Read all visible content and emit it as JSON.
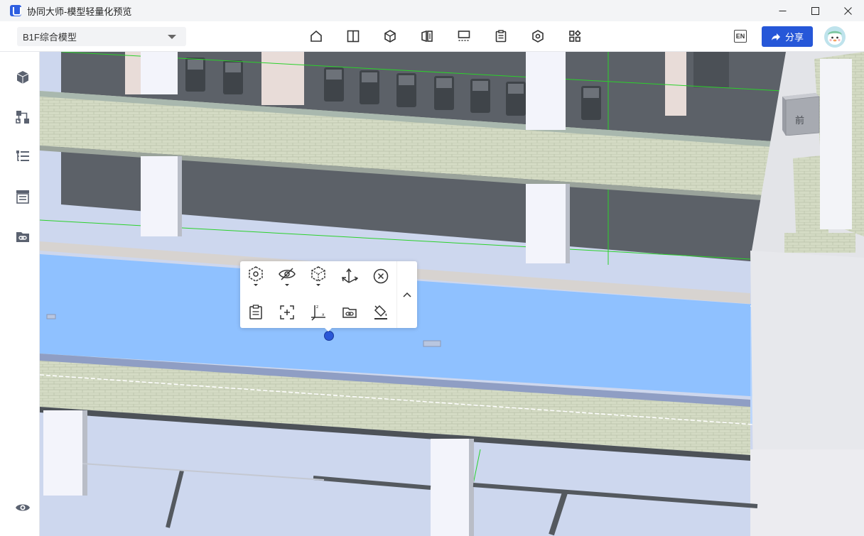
{
  "window": {
    "title": "协同大师-模型轻量化预览",
    "controls": [
      "minimize-icon",
      "maximize-icon",
      "close-icon"
    ]
  },
  "toolbar": {
    "model_selector": {
      "value": "B1F综合模型"
    },
    "tools": [
      "home-icon",
      "split-view-icon",
      "model-tree-icon",
      "section-icon",
      "measure-icon",
      "clipboard-icon",
      "component-icon",
      "layout-icon"
    ],
    "language_badge": "EN",
    "share_label": "分享"
  },
  "sidebar": {
    "items": [
      "cube-icon",
      "hierarchy-icon",
      "list-tree-icon",
      "properties-icon",
      "link-folder-icon"
    ],
    "bottom_item": "eye-icon"
  },
  "viewcube": {
    "face_label": "前"
  },
  "context_toolbar": {
    "row1": [
      "isolate-icon",
      "hide-icon",
      "section-box-icon",
      "transform-icon",
      "close-circle-icon"
    ],
    "row2": [
      "properties-icon",
      "zoom-fit-icon",
      "axis-icon",
      "link-folder-icon",
      "paint-bucket-icon"
    ]
  },
  "colors": {
    "accent": "#2657d8",
    "selection": "#8fc1ff",
    "wall": "#d6dcc7",
    "floor": "#cfd8ee"
  }
}
